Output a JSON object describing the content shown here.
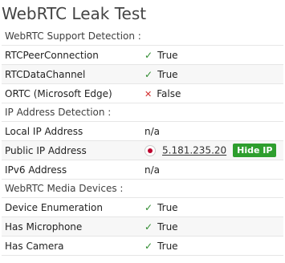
{
  "page": {
    "title": "WebRTC Leak Test"
  },
  "sections": {
    "support": {
      "heading": "WebRTC Support Detection :",
      "rows": [
        {
          "label": "RTCPeerConnection",
          "value": "True",
          "status": "true"
        },
        {
          "label": "RTCDataChannel",
          "value": "True",
          "status": "true"
        },
        {
          "label": "ORTC (Microsoft Edge)",
          "value": "False",
          "status": "false"
        }
      ]
    },
    "ip": {
      "heading": "IP Address Detection :",
      "local": {
        "label": "Local IP Address",
        "value": "n/a"
      },
      "public": {
        "label": "Public IP Address",
        "value": "5.181.235.20",
        "button": "Hide IP",
        "flag_icon": "japan-flag-icon"
      },
      "ipv6": {
        "label": "IPv6 Address",
        "value": "n/a"
      }
    },
    "media": {
      "heading": "WebRTC Media Devices :",
      "rows": [
        {
          "label": "Device Enumeration",
          "value": "True",
          "status": "true"
        },
        {
          "label": "Has Microphone",
          "value": "True",
          "status": "true"
        },
        {
          "label": "Has Camera",
          "value": "True",
          "status": "true"
        }
      ]
    }
  },
  "icons": {
    "check": "✓",
    "cross": "✕"
  },
  "colors": {
    "check": "#2e8b2e",
    "cross": "#d22b2b",
    "button": "#2e9e2e"
  }
}
